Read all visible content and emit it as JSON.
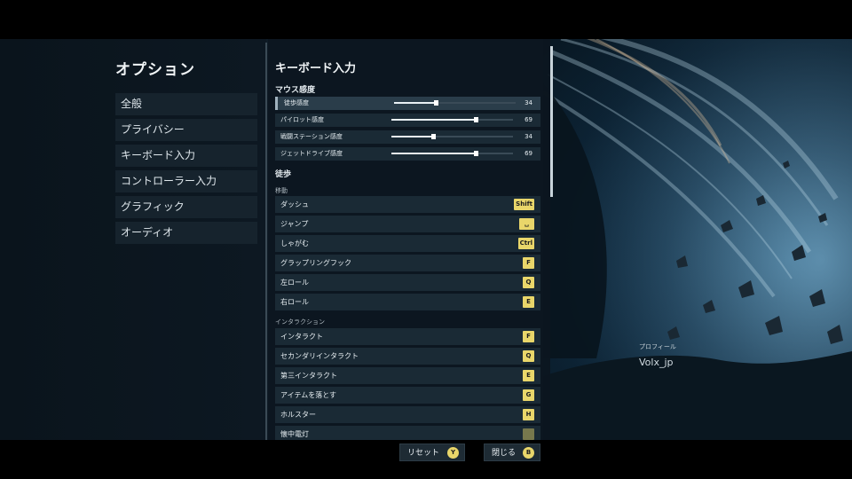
{
  "sidebar": {
    "title": "オプション",
    "items": [
      {
        "label": "全般"
      },
      {
        "label": "プライバシー"
      },
      {
        "label": "キーボード入力"
      },
      {
        "label": "コントローラー入力"
      },
      {
        "label": "グラフィック"
      },
      {
        "label": "オーディオ"
      }
    ]
  },
  "main": {
    "title": "キーボード入力",
    "mouse_section": "マウス感度",
    "sliders": [
      {
        "label": "徒歩感度",
        "value": "34",
        "fraction": 0.34
      },
      {
        "label": "パイロット感度",
        "value": "69",
        "fraction": 0.69
      },
      {
        "label": "戦闘ステーション感度",
        "value": "34",
        "fraction": 0.34
      },
      {
        "label": "ジェットドライブ感度",
        "value": "69",
        "fraction": 0.69
      }
    ],
    "walk_section": "徒歩",
    "movement_heading": "移動",
    "movement_binds": [
      {
        "label": "ダッシュ",
        "key": "Shift"
      },
      {
        "label": "ジャンプ",
        "key": "␣"
      },
      {
        "label": "しゃがむ",
        "key": "Ctrl"
      },
      {
        "label": "グラップリングフック",
        "key": "F"
      },
      {
        "label": "左ロール",
        "key": "Q"
      },
      {
        "label": "右ロール",
        "key": "E"
      }
    ],
    "interaction_heading": "インタラクション",
    "interaction_binds": [
      {
        "label": "インタラクト",
        "key": "F"
      },
      {
        "label": "セカンダリインタラクト",
        "key": "Q"
      },
      {
        "label": "第三インタラクト",
        "key": "E"
      },
      {
        "label": "アイテムを落とす",
        "key": "G"
      },
      {
        "label": "ホルスター",
        "key": "H"
      },
      {
        "label": "懐中電灯",
        "key": ""
      }
    ]
  },
  "profile": {
    "label": "プロフィール",
    "name": "Volx_jp"
  },
  "footer": {
    "reset_label": "リセット",
    "reset_key": "Y",
    "close_label": "閉じる",
    "close_key": "B"
  },
  "colors": {
    "accent": "#e9d66a",
    "panel": "#1a2a35",
    "background": "#0d1924"
  }
}
